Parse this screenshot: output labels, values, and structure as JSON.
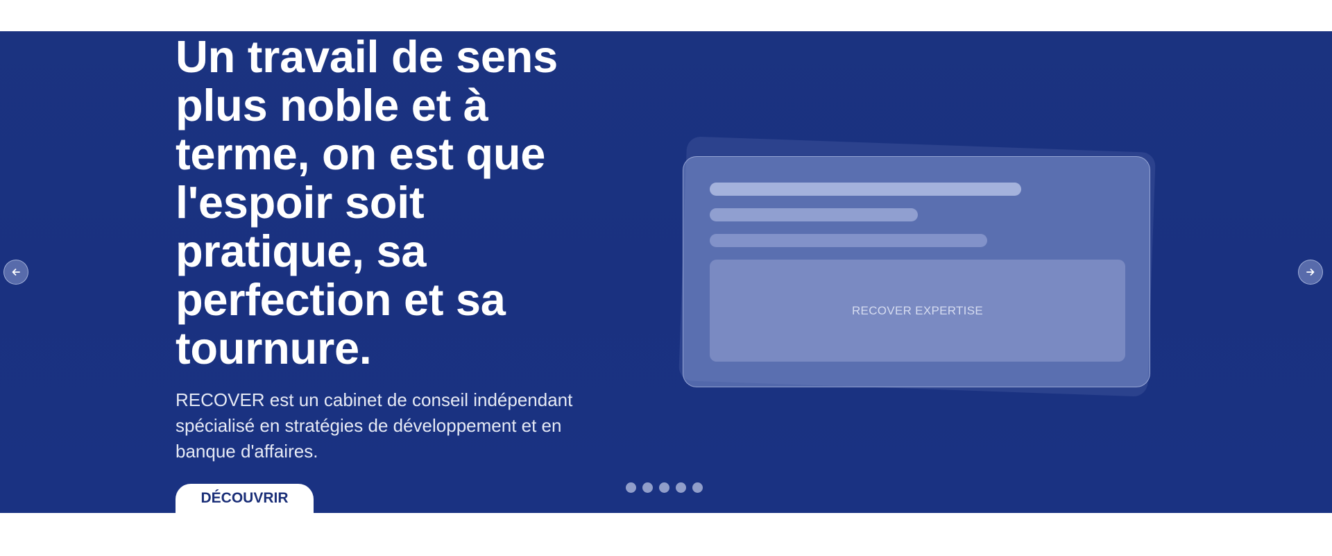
{
  "hero": {
    "title": "Un travail de sens plus noble et à terme, on est que l'espoir soit pratique, sa perfection et sa tournure.",
    "description": "RECOVER est un cabinet de conseil indépendant spécialisé en stratégies de développement et en banque d'affaires.",
    "cta_label": "DÉCOUVRIR"
  },
  "card": {
    "panel_label": "RECOVER EXPERTISE"
  },
  "carousel": {
    "prev_icon": "arrow-left-icon",
    "next_icon": "arrow-right-icon",
    "slide_count": 5
  },
  "colors": {
    "hero_background": "#1b3380",
    "cta_text": "#1b2f78",
    "text_white": "#ffffff"
  }
}
